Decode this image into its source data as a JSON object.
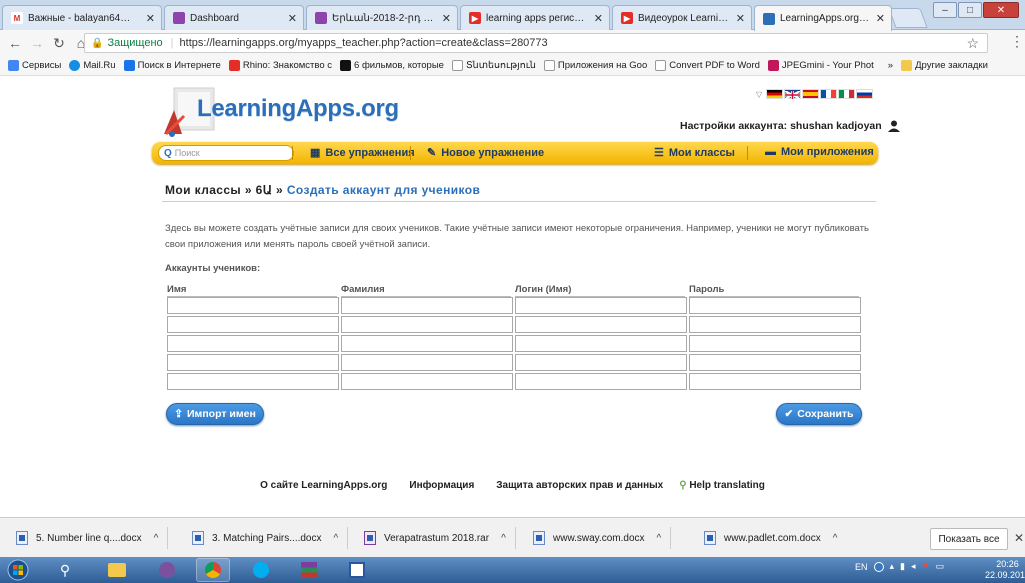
{
  "browser": {
    "tabs": [
      {
        "title": "Важные - balayan64@gm",
        "color": "#d93025",
        "glyph": "M"
      },
      {
        "title": "Dashboard",
        "color": "#8e44ad",
        "glyph": ""
      },
      {
        "title": "Երևան-2018-2-րդ խումբ",
        "color": "#8e44ad",
        "glyph": ""
      },
      {
        "title": "learning apps регистрац",
        "color": "#e52d27",
        "glyph": "▶"
      },
      {
        "title": "Видеоурок LearningApps",
        "color": "#e52d27",
        "glyph": "▶"
      },
      {
        "title": "LearningApps.org - созд",
        "color": "#2c6fb8",
        "glyph": ""
      }
    ],
    "secure_label": "Защищено",
    "url": "https://learningapps.org/myapps_teacher.php?action=create&class=280773",
    "bookmarks": [
      {
        "label": "Сервисы",
        "color": "#4285f4"
      },
      {
        "label": "Mail.Ru",
        "color": "#168de2"
      },
      {
        "label": "Поиск в Интернете",
        "color": "#1a73e8"
      },
      {
        "label": "Rhino: Знакомство с",
        "color": "#e52d27"
      },
      {
        "label": "6 фильмов, которые",
        "color": "#111111"
      },
      {
        "label": "Տնտեսություն",
        "color": "#dddddd"
      },
      {
        "label": "Приложения на Goo",
        "color": "#dddddd"
      },
      {
        "label": "Convert PDF to Word",
        "color": "#dddddd"
      },
      {
        "label": "JPEGmini - Your Phot",
        "color": "#c2185b"
      }
    ],
    "bookmarks_more": "»",
    "other_bookmarks": "Другие закладки"
  },
  "site": {
    "logo": "LearningApps.org",
    "account_label": "Настройки аккаунта: shushan kadjoyan",
    "search_placeholder": "Поиск",
    "nav": {
      "all": "Все упражнения",
      "new": "Новое упражнение",
      "classes": "Мои классы",
      "apps": "Мои приложения"
    }
  },
  "breadcrumb": {
    "root": "Мои классы",
    "sep1": "»",
    "class_name": "6Ա",
    "sep2": "»",
    "current": "Создать аккаунт для учеников"
  },
  "description": "Здесь вы можете создать учётные записи для своих учеников. Такие учётные записи имеют некоторые ограничения. Например, ученики не могут публиковать свои приложения или менять пароль своей учётной записи.",
  "accounts_label": "Аккаунты учеников:",
  "columns": {
    "first": "Имя",
    "last": "Фамилия",
    "login": "Логин (Имя)",
    "password": "Пароль"
  },
  "buttons": {
    "import": "Импорт имен",
    "save": "Сохранить"
  },
  "footer": {
    "about": "О сайте LearningApps.org",
    "info": "Информация",
    "privacy": "Защита авторских прав и данных",
    "translate": "Help translating"
  },
  "downloads": [
    "5. Number line q....docx",
    "3. Matching Pairs....docx",
    "Verapatrastum 2018.rar",
    "www.sway.com.docx",
    "www.padlet.com.docx"
  ],
  "show_all": "Показать все",
  "taskbar": {
    "lang": "EN",
    "time": "20:26",
    "date": "22.09.2018"
  }
}
